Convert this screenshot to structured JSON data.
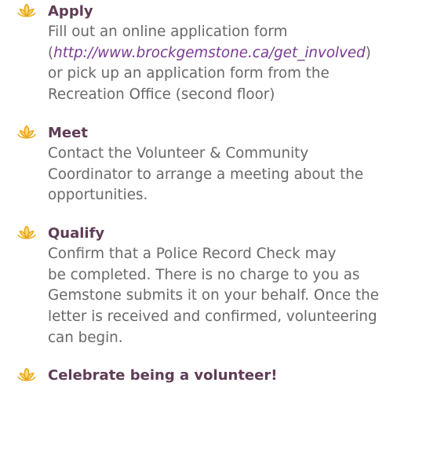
{
  "colors": {
    "icon_fill": "#f9dc7c",
    "icon_stroke": "#e9a81b",
    "heading": "#5f3c55",
    "body_text": "#686868",
    "link": "#7a3a93"
  },
  "steps": [
    {
      "icon": "lotus-icon",
      "title": "Apply",
      "lines": [
        "Fill out an online application form",
        "(",
        "http://www.brockgemstone.ca/get_involved",
        ")",
        "or pick up an application form from the",
        "Recreation Office (second floor)"
      ]
    },
    {
      "icon": "lotus-icon",
      "title": "Meet",
      "lines": [
        "Contact the Volunteer & Community",
        "Coordinator to arrange a meeting about the",
        "opportunities."
      ]
    },
    {
      "icon": "lotus-icon",
      "title": "Qualify",
      "lines": [
        "Confirm that a Police Record Check may",
        "be completed. There is no charge to you as",
        "Gemstone submits it on your behalf. Once the",
        "letter is received and confirmed, volunteering",
        "can begin."
      ]
    },
    {
      "icon": "lotus-icon",
      "title": "Celebrate being a volunteer!",
      "lines": []
    }
  ]
}
